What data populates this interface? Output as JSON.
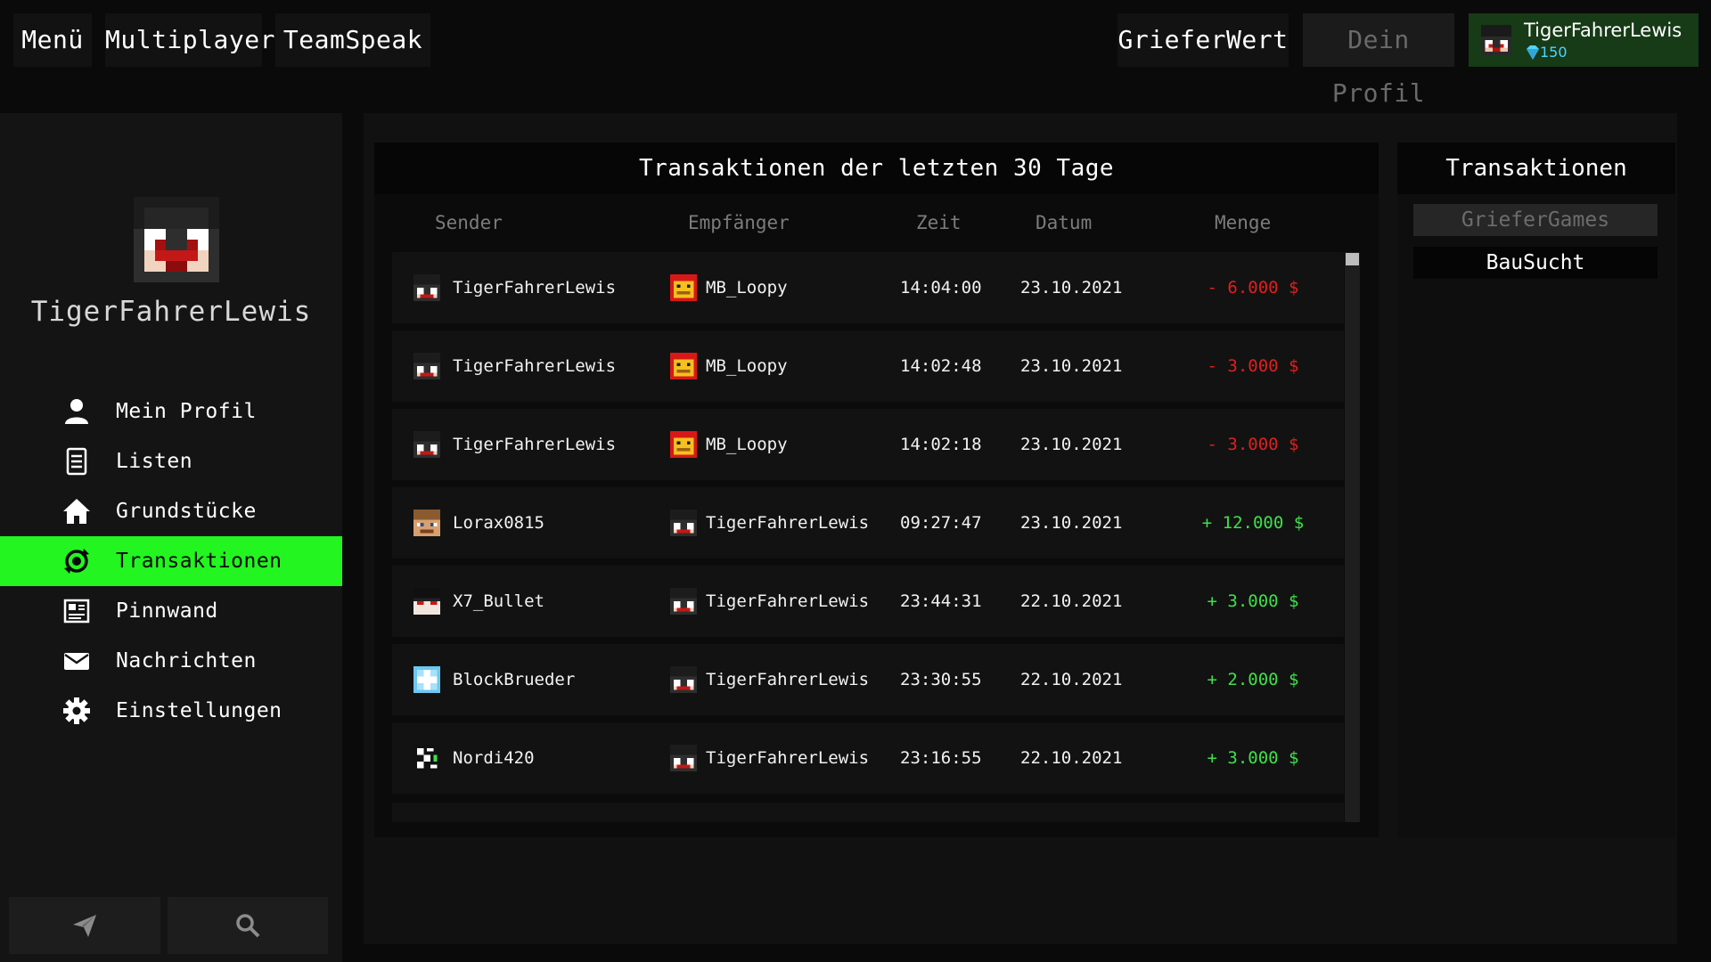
{
  "topbar": {
    "menu": "Menü",
    "multiplayer": "Multiplayer",
    "teamspeak": "TeamSpeak",
    "grieferwert": "GrieferWert",
    "dein_profil": "Dein Profil",
    "username": "TigerFahrerLewis",
    "gems": "150"
  },
  "sidebar": {
    "profile_name": "TigerFahrerLewis",
    "items": [
      {
        "label": "Mein Profil",
        "icon": "user-icon"
      },
      {
        "label": "Listen",
        "icon": "list-icon"
      },
      {
        "label": "Grundstücke",
        "icon": "home-icon"
      },
      {
        "label": "Transaktionen",
        "icon": "transaction-icon",
        "active": true
      },
      {
        "label": "Pinnwand",
        "icon": "pinboard-icon"
      },
      {
        "label": "Nachrichten",
        "icon": "mail-icon"
      },
      {
        "label": "Einstellungen",
        "icon": "gear-icon"
      }
    ],
    "bottom_buttons": [
      "send-icon",
      "search-icon"
    ]
  },
  "transactions": {
    "title": "Transaktionen der letzten 30 Tage",
    "columns": [
      "Sender",
      "Empfänger",
      "Zeit",
      "Datum",
      "Menge"
    ],
    "rows": [
      {
        "sender": "TigerFahrerLewis",
        "receiver": "MB_Loopy",
        "time": "14:04:00",
        "date": "23.10.2021",
        "amount": "- 6.000 $",
        "dir": "neg"
      },
      {
        "sender": "TigerFahrerLewis",
        "receiver": "MB_Loopy",
        "time": "14:02:48",
        "date": "23.10.2021",
        "amount": "- 3.000 $",
        "dir": "neg"
      },
      {
        "sender": "TigerFahrerLewis",
        "receiver": "MB_Loopy",
        "time": "14:02:18",
        "date": "23.10.2021",
        "amount": "- 3.000 $",
        "dir": "neg"
      },
      {
        "sender": "Lorax0815",
        "receiver": "TigerFahrerLewis",
        "time": "09:27:47",
        "date": "23.10.2021",
        "amount": "+ 12.000 $",
        "dir": "pos"
      },
      {
        "sender": "X7_Bullet",
        "receiver": "TigerFahrerLewis",
        "time": "23:44:31",
        "date": "22.10.2021",
        "amount": "+ 3.000 $",
        "dir": "pos"
      },
      {
        "sender": "BlockBrueder",
        "receiver": "TigerFahrerLewis",
        "time": "23:30:55",
        "date": "22.10.2021",
        "amount": "+ 2.000 $",
        "dir": "pos"
      },
      {
        "sender": "Nordi420",
        "receiver": "TigerFahrerLewis",
        "time": "23:16:55",
        "date": "22.10.2021",
        "amount": "+ 3.000 $",
        "dir": "pos"
      }
    ]
  },
  "server_panel": {
    "title": "Transaktionen",
    "servers": [
      {
        "label": "GrieferGames",
        "active": false
      },
      {
        "label": "BauSucht",
        "active": true
      }
    ]
  },
  "colors": {
    "accent_green": "#22f51f",
    "negative": "#e01f1f",
    "positive": "#3ee04a",
    "gem": "#4fd4ff"
  }
}
